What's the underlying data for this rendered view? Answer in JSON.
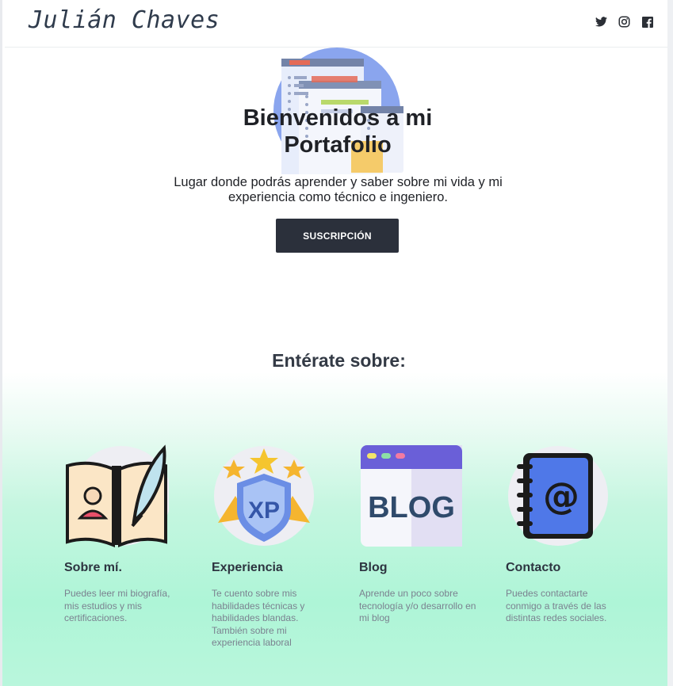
{
  "header": {
    "brand": "Julián Chaves",
    "socials": [
      {
        "icon": "twitter-icon"
      },
      {
        "icon": "instagram-icon"
      },
      {
        "icon": "facebook-icon"
      }
    ]
  },
  "hero": {
    "title": "Bienvenidos a mi Portafolio",
    "subtitle": "Lugar donde podrás aprender y saber sobre mi vida y mi experiencia como técnico e ingeniero.",
    "button_label": "SUSCRIPCIÓN",
    "illustration_icon": "code-windows-icon"
  },
  "about": {
    "title": "Entérate sobre:",
    "cards": [
      {
        "title": "Sobre mí.",
        "description": "Puedes leer mi biografía, mis estudios y mis certificaciones.",
        "icon": "book-quill-icon"
      },
      {
        "title": "Experiencia",
        "description": "Te cuento sobre mis habilidades técnicas y habilidades blandas. También sobre mi experiencia laboral",
        "icon": "xp-badge-icon"
      },
      {
        "title": "Blog",
        "description": "Aprende un poco sobre tecnología y/o desarrollo en mi blog",
        "icon": "blog-window-icon"
      },
      {
        "title": "Contacto",
        "description": "Puedes contactarte conmigo a través de las distintas redes sociales.",
        "icon": "address-book-icon"
      }
    ]
  },
  "colors": {
    "button_bg": "#2b303b",
    "gradient_mint": "#aef5d7",
    "blue": "#5b7fe6",
    "yellow": "#f2b632"
  }
}
